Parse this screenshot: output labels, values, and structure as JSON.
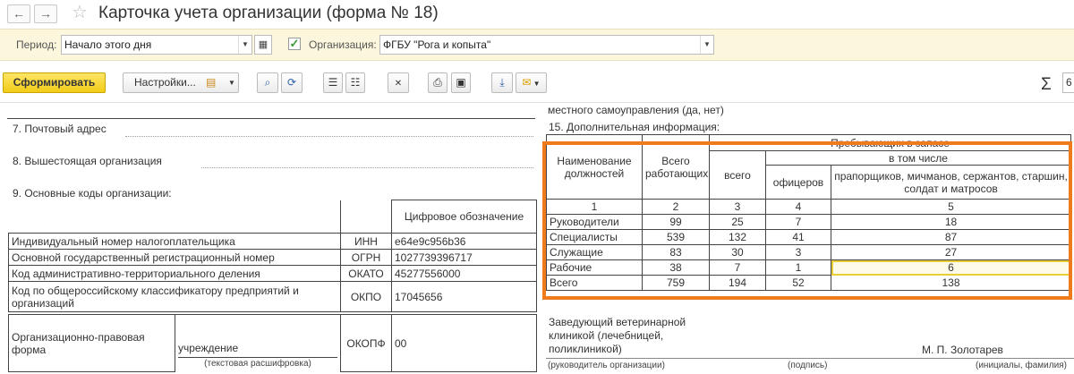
{
  "header": {
    "title": "Карточка учета организации (форма № 18)",
    "back_icon": "arrow-left-icon",
    "forward_icon": "arrow-right-icon",
    "favorite_icon": "star-icon"
  },
  "filters": {
    "period_label": "Период:",
    "period_value": "Начало этого дня",
    "org_label": "Организация:",
    "org_value": "ФГБУ \"Рога и копыта\"",
    "org_checked": true
  },
  "toolbar": {
    "generate": "Сформировать",
    "settings": "Настройки...",
    "sigma": "Σ",
    "zoom_value": "6"
  },
  "report": {
    "top_cut_text": "местного самоуправления (да, нет)",
    "postal_label": "7. Почтовый адрес",
    "parent_org_label": "8. Вышестоящая организация",
    "codes_label": "9. Основные коды организации:",
    "codes_header": "Цифровое обозначение",
    "codes": [
      {
        "name": "Индивидуальный номер налогоплательщика",
        "code": "ИНН",
        "value": "e64e9c956b36"
      },
      {
        "name": "Основной государственный регистрационный номер",
        "code": "ОГРН",
        "value": "1027739396717"
      },
      {
        "name": "Код административно-территориального деления",
        "code": "ОКАТО",
        "value": "45277556000"
      },
      {
        "name": "Код по общероссийскому классификатору предприятий и организаций",
        "code": "ОКПО",
        "value": "17045656"
      }
    ],
    "legal_form": {
      "label": "Организационно-правовая форма",
      "text": "учреждение",
      "caption": "(текстовая расшифровка)",
      "code": "ОКОПФ",
      "value": "00"
    },
    "additional": {
      "title": "15. Дополнительная информация:",
      "col_name": "Наименование должностей",
      "col_total": "Всего работающих",
      "col_reserve": "Пребывающих в запасе",
      "col_all": "всего",
      "col_incl": "в том числе",
      "col_officers": "офицеров",
      "col_others": "прапорщиков, мичманов, сержантов, старшин, солдат и матросов",
      "col_nums": [
        "1",
        "2",
        "3",
        "4",
        "5"
      ],
      "rows": [
        {
          "name": "Руководители",
          "total": "99",
          "all": "25",
          "officers": "7",
          "others": "18"
        },
        {
          "name": "Специалисты",
          "total": "539",
          "all": "132",
          "officers": "41",
          "others": "87"
        },
        {
          "name": "Служащие",
          "total": "83",
          "all": "30",
          "officers": "3",
          "others": "27"
        },
        {
          "name": "Рабочие",
          "total": "38",
          "all": "7",
          "officers": "1",
          "others": "6"
        },
        {
          "name": "Всего",
          "total": "759",
          "all": "194",
          "officers": "52",
          "others": "138"
        }
      ]
    },
    "signature": {
      "position": "Заведующий ветеринарной клиникой (лечебницей, поликлиникой)",
      "name": "М. П. Золотарев",
      "cap_head": "(руководитель организации)",
      "cap_sign": "(подпись)",
      "cap_initials": "(инициалы, фамилия)"
    }
  }
}
